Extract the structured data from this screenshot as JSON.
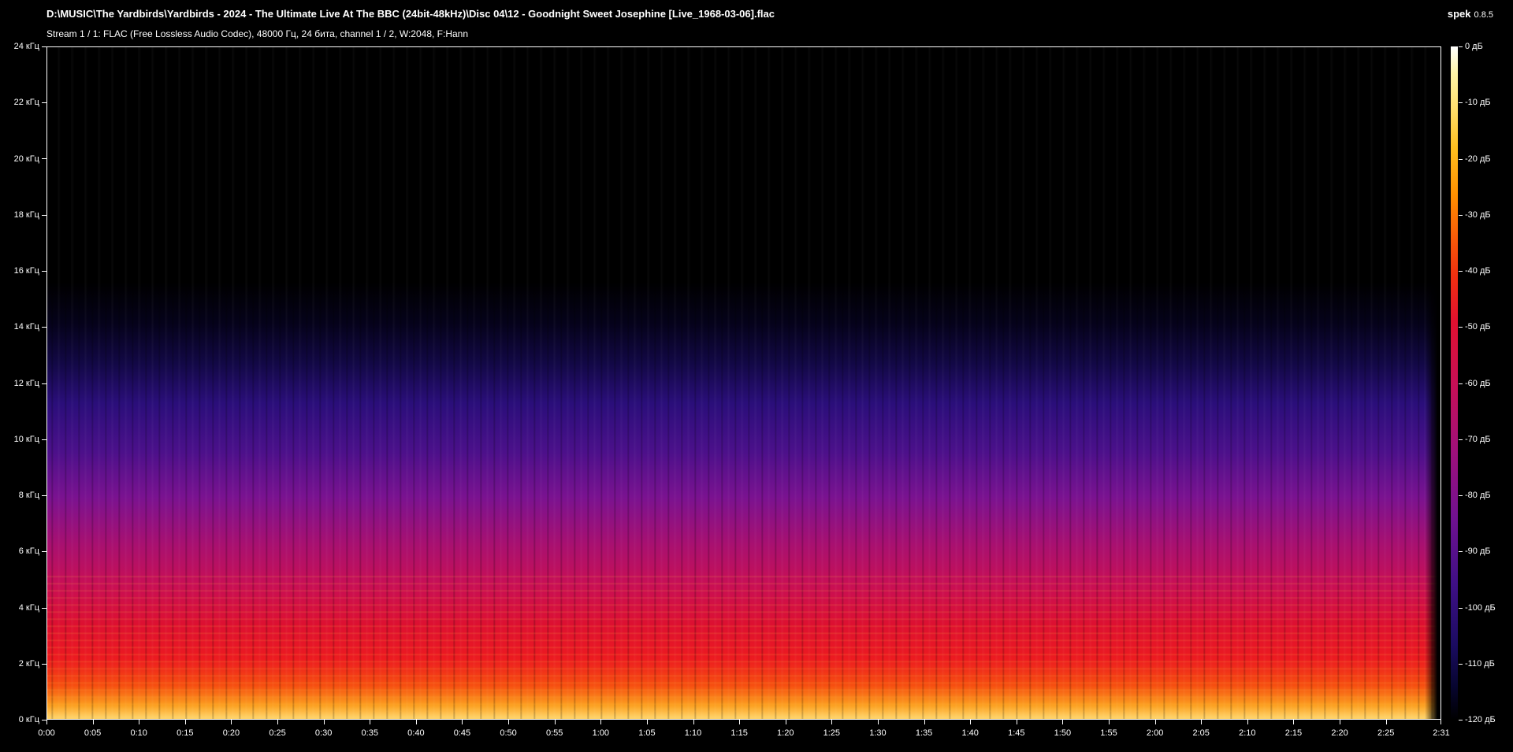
{
  "window": {
    "file_title": "D:\\MUSIC\\The Yardbirds\\Yardbirds - 2024 - The Ultimate Live At The BBC (24bit-48kHz)\\Disc 04\\12 - Goodnight Sweet Josephine [Live_1968-03-06].flac",
    "stream_info": "Stream 1 / 1: FLAC (Free Lossless Audio Codec), 48000 Гц, 24 бита, channel 1 / 2, W:2048, F:Hann",
    "app_name": "spek",
    "app_version": "0.8.5"
  },
  "chart_data": {
    "type": "heatmap",
    "title": "",
    "y_ticks": [
      {
        "value": 24,
        "label": "24 кГц"
      },
      {
        "value": 22,
        "label": "22 кГц"
      },
      {
        "value": 20,
        "label": "20 кГц"
      },
      {
        "value": 18,
        "label": "18 кГц"
      },
      {
        "value": 16,
        "label": "16 кГц"
      },
      {
        "value": 14,
        "label": "14 кГц"
      },
      {
        "value": 12,
        "label": "12 кГц"
      },
      {
        "value": 10,
        "label": "10 кГц"
      },
      {
        "value": 8,
        "label": "8 кГц"
      },
      {
        "value": 6,
        "label": "6 кГц"
      },
      {
        "value": 4,
        "label": "4 кГц"
      },
      {
        "value": 2,
        "label": "2 кГц"
      },
      {
        "value": 0,
        "label": "0 кГц"
      }
    ],
    "x_ticks": [
      {
        "value": 0,
        "label": "0:00"
      },
      {
        "value": 5,
        "label": "0:05"
      },
      {
        "value": 10,
        "label": "0:10"
      },
      {
        "value": 15,
        "label": "0:15"
      },
      {
        "value": 20,
        "label": "0:20"
      },
      {
        "value": 25,
        "label": "0:25"
      },
      {
        "value": 30,
        "label": "0:30"
      },
      {
        "value": 35,
        "label": "0:35"
      },
      {
        "value": 40,
        "label": "0:40"
      },
      {
        "value": 45,
        "label": "0:45"
      },
      {
        "value": 50,
        "label": "0:50"
      },
      {
        "value": 55,
        "label": "0:55"
      },
      {
        "value": 60,
        "label": "1:00"
      },
      {
        "value": 65,
        "label": "1:05"
      },
      {
        "value": 70,
        "label": "1:10"
      },
      {
        "value": 75,
        "label": "1:15"
      },
      {
        "value": 80,
        "label": "1:20"
      },
      {
        "value": 85,
        "label": "1:25"
      },
      {
        "value": 90,
        "label": "1:30"
      },
      {
        "value": 95,
        "label": "1:35"
      },
      {
        "value": 100,
        "label": "1:40"
      },
      {
        "value": 105,
        "label": "1:45"
      },
      {
        "value": 110,
        "label": "1:50"
      },
      {
        "value": 115,
        "label": "1:55"
      },
      {
        "value": 120,
        "label": "2:00"
      },
      {
        "value": 125,
        "label": "2:05"
      },
      {
        "value": 130,
        "label": "2:10"
      },
      {
        "value": 135,
        "label": "2:15"
      },
      {
        "value": 140,
        "label": "2:20"
      },
      {
        "value": 145,
        "label": "2:25"
      },
      {
        "value": 151,
        "label": "2:31"
      }
    ],
    "colorbar_ticks": [
      {
        "value": 0,
        "label": "0 дБ"
      },
      {
        "value": -10,
        "label": "-10 дБ"
      },
      {
        "value": -20,
        "label": "-20 дБ"
      },
      {
        "value": -30,
        "label": "-30 дБ"
      },
      {
        "value": -40,
        "label": "-40 дБ"
      },
      {
        "value": -50,
        "label": "-50 дБ"
      },
      {
        "value": -60,
        "label": "-60 дБ"
      },
      {
        "value": -70,
        "label": "-70 дБ"
      },
      {
        "value": -80,
        "label": "-80 дБ"
      },
      {
        "value": -90,
        "label": "-90 дБ"
      },
      {
        "value": -100,
        "label": "-100 дБ"
      },
      {
        "value": -110,
        "label": "-110 дБ"
      },
      {
        "value": -120,
        "label": "-120 дБ"
      }
    ],
    "ylim": [
      0,
      24
    ],
    "xlim": [
      0,
      151
    ],
    "zlim": [
      -120,
      0
    ],
    "spectral_cutoff_khz": 13,
    "colormap": [
      "#000000",
      "#1a0b60",
      "#701190",
      "#c80f55",
      "#f03010",
      "#ff9000",
      "#ffe070",
      "#ffffff"
    ]
  }
}
